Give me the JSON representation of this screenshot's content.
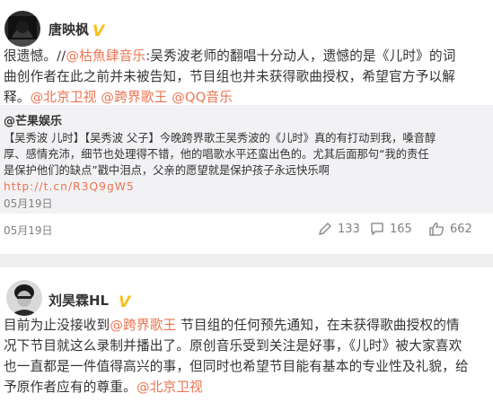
{
  "post1": {
    "author": "唐映枫",
    "text_lines": [
      [
        "很遗憾。//",
        {
          "link": "@枯魚肆音乐"
        },
        ":吴秀波老师的翻唱十分动人，遗憾的是《儿时》的词"
      ],
      [
        "曲创作者在此之前并未被告知，节目组也并未获得歌曲授权，希望官方予以解"
      ],
      [
        "释。",
        {
          "link": "@北京卫视"
        },
        " ",
        {
          "link": "@跨界歌王"
        },
        " ",
        {
          "link": "@QQ音乐"
        }
      ]
    ],
    "repost": {
      "author": "@芒果娱乐",
      "text_lines": [
        "【吴秀波 儿时】【吴秀波 父子】今晚跨界歌王吴秀波的《儿时》真的有打动到我，嗓音醇",
        "厚、感情充沛，细节也处理得不错，他的唱歌水平还蛮出色的。尤其后面那句“我的责任",
        "是保护他们的缺点”戳中泪点，父亲的愿望就是保护孩子永远快乐啊"
      ],
      "url": "http://t.cn/R3Q9gW5",
      "date": "05月19日"
    },
    "date": "05月19日",
    "actions": {
      "share": "133",
      "comment": "165",
      "like": "662"
    }
  },
  "post2": {
    "author": "刘昊霖HL",
    "text_lines": [
      [
        "目前为止没接收到",
        {
          "link": "@跨界歌王"
        },
        " 节目组的任何预先通知，在未获得歌曲授权的情"
      ],
      [
        "况下节目就这么录制并播出了。原创音乐受到关注是好事，《儿时》被大家喜欢"
      ],
      [
        "也一直都是一件值得高兴的事，但同时也希望节目能有基本的专业性及礼貌，给"
      ],
      [
        "予原作者应有的尊重。",
        {
          "link": "@北京卫视"
        }
      ]
    ]
  },
  "colors": {
    "link": "#eb7350",
    "badge": "#f6c11a",
    "muted": "#808080",
    "repost_bg": "#f2f2f5"
  }
}
